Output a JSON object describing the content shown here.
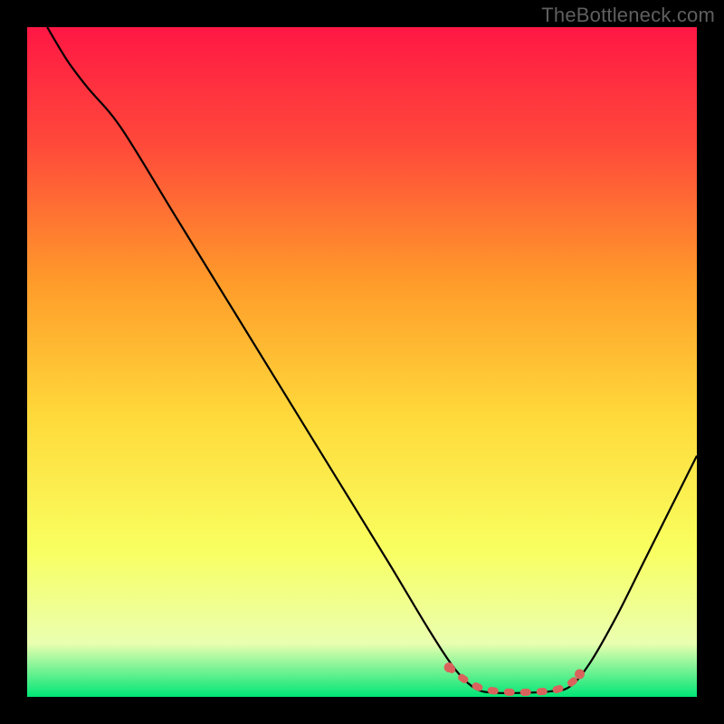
{
  "watermark": "TheBottleneck.com",
  "chart_data": {
    "type": "line",
    "title": "",
    "xlabel": "",
    "ylabel": "",
    "xlim": [
      0,
      100
    ],
    "ylim": [
      0,
      100
    ],
    "gradient_stops": [
      {
        "offset": 0,
        "color": "#ff1744"
      },
      {
        "offset": 18,
        "color": "#ff4b3a"
      },
      {
        "offset": 38,
        "color": "#ff9b2a"
      },
      {
        "offset": 58,
        "color": "#ffd93a"
      },
      {
        "offset": 78,
        "color": "#f9ff60"
      },
      {
        "offset": 92,
        "color": "#eaffb0"
      },
      {
        "offset": 100,
        "color": "#00e676"
      }
    ],
    "series": [
      {
        "name": "bottleneck-curve",
        "color": "#000000",
        "points": [
          {
            "x": 3,
            "y": 100
          },
          {
            "x": 6,
            "y": 95
          },
          {
            "x": 9,
            "y": 91
          },
          {
            "x": 14,
            "y": 85
          },
          {
            "x": 22,
            "y": 72
          },
          {
            "x": 30,
            "y": 59
          },
          {
            "x": 38,
            "y": 46
          },
          {
            "x": 46,
            "y": 33
          },
          {
            "x": 54,
            "y": 20
          },
          {
            "x": 60,
            "y": 10
          },
          {
            "x": 64,
            "y": 4
          },
          {
            "x": 67,
            "y": 1.2
          },
          {
            "x": 70,
            "y": 0.6
          },
          {
            "x": 74,
            "y": 0.6
          },
          {
            "x": 78,
            "y": 0.8
          },
          {
            "x": 81,
            "y": 1.5
          },
          {
            "x": 84,
            "y": 5
          },
          {
            "x": 88,
            "y": 12
          },
          {
            "x": 92,
            "y": 20
          },
          {
            "x": 96,
            "y": 28
          },
          {
            "x": 100,
            "y": 36
          }
        ]
      },
      {
        "name": "optimal-range-marker",
        "color": "#d9635c",
        "points": [
          {
            "x": 63,
            "y": 4.4
          },
          {
            "x": 64,
            "y": 3.6
          },
          {
            "x": 65,
            "y": 2.8
          },
          {
            "x": 67,
            "y": 1.6
          },
          {
            "x": 69,
            "y": 1.0
          },
          {
            "x": 72,
            "y": 0.7
          },
          {
            "x": 75,
            "y": 0.7
          },
          {
            "x": 78,
            "y": 0.9
          },
          {
            "x": 80,
            "y": 1.4
          },
          {
            "x": 81.5,
            "y": 2.3
          },
          {
            "x": 82.5,
            "y": 3.4
          }
        ]
      }
    ]
  }
}
